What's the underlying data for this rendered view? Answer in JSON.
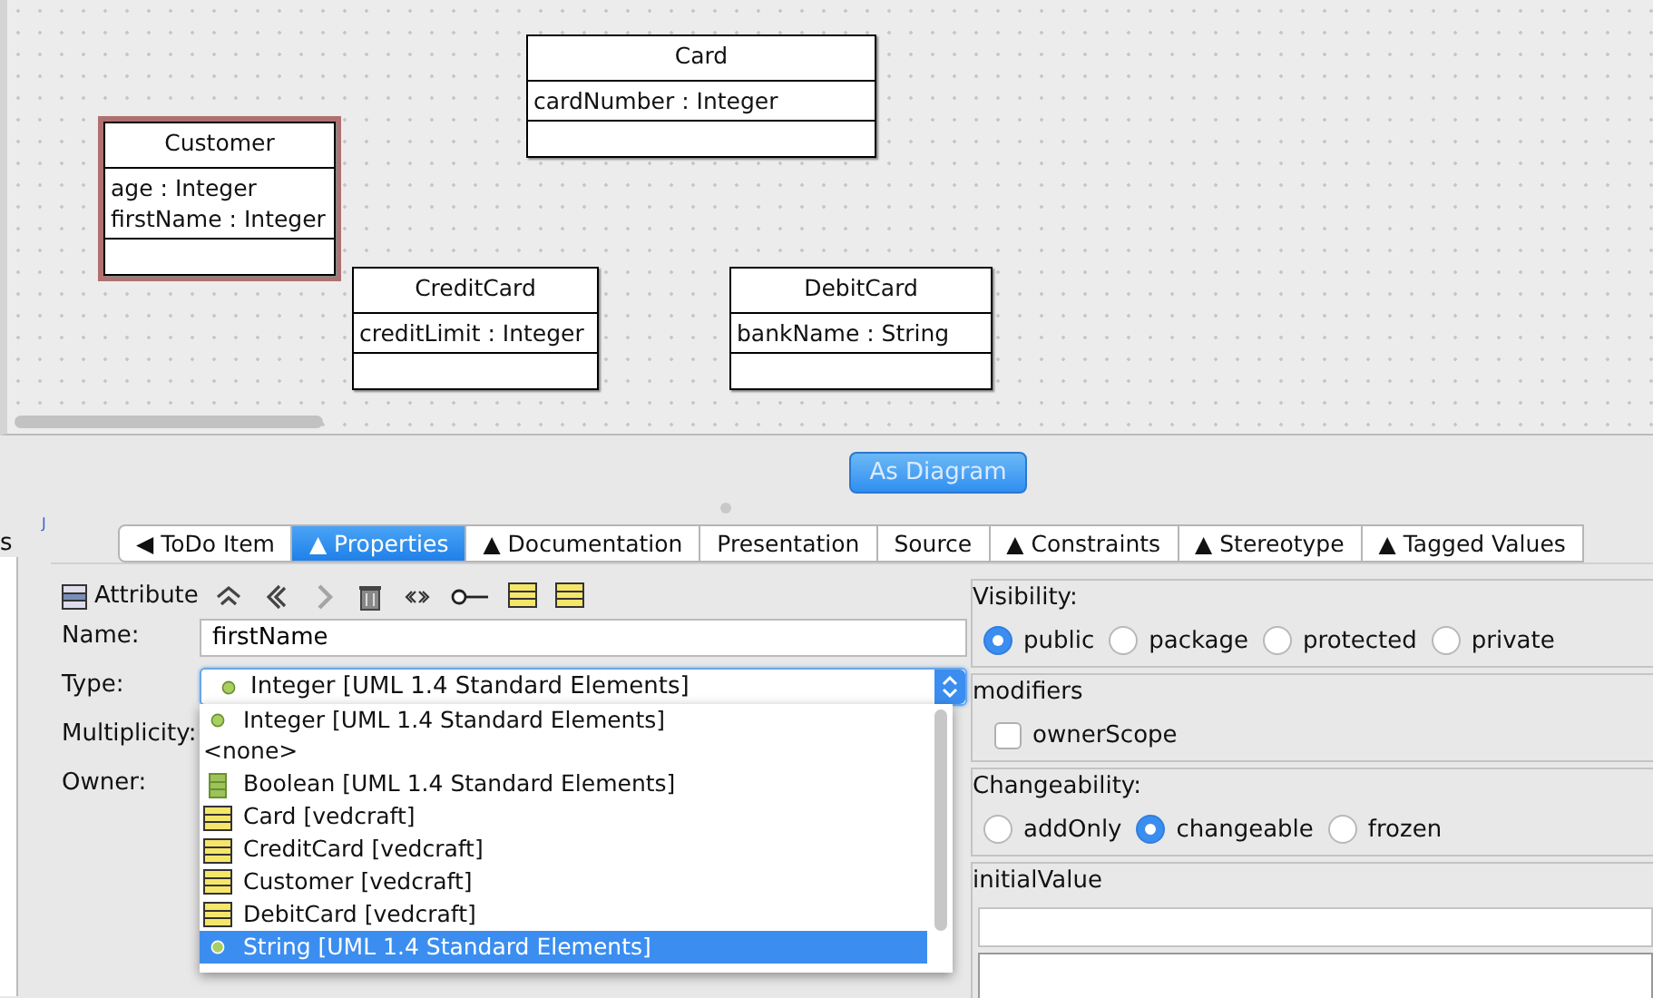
{
  "diagram": {
    "classes": [
      {
        "name": "Card",
        "attributes": [
          "cardNumber : Integer"
        ],
        "selected": false
      },
      {
        "name": "Customer",
        "attributes": [
          "age : Integer",
          "firstName : Integer"
        ],
        "selected": true
      },
      {
        "name": "CreditCard",
        "attributes": [
          "creditLimit : Integer"
        ],
        "selected": false
      },
      {
        "name": "DebitCard",
        "attributes": [
          "bankName : String"
        ],
        "selected": false
      }
    ]
  },
  "view_button": "As Diagram",
  "side_panel": {
    "label": "s",
    "mark": "J"
  },
  "tabs": [
    {
      "label": "◀ ToDo Item",
      "selected": false
    },
    {
      "label": "▲ Properties",
      "selected": true
    },
    {
      "label": "▲ Documentation",
      "selected": false
    },
    {
      "label": "Presentation",
      "selected": false
    },
    {
      "label": "Source",
      "selected": false
    },
    {
      "label": "▲ Constraints",
      "selected": false
    },
    {
      "label": "▲ Stereotype",
      "selected": false
    },
    {
      "label": "▲ Tagged Values",
      "selected": false
    }
  ],
  "toolbar": {
    "title": "Attribute",
    "tools": [
      {
        "kind": "up",
        "disabled": false
      },
      {
        "kind": "back",
        "disabled": false
      },
      {
        "kind": "forward",
        "disabled": true
      },
      {
        "kind": "delete",
        "disabled": false
      },
      {
        "kind": "stereotype",
        "disabled": false
      },
      {
        "kind": "key",
        "disabled": false
      },
      {
        "kind": "class",
        "disabled": false
      },
      {
        "kind": "class",
        "disabled": false
      }
    ]
  },
  "fields": {
    "name_label": "Name:",
    "name_value": "firstName",
    "type_label": "Type:",
    "type_value": "Integer [UML 1.4 Standard Elements]",
    "multiplicity_label": "Multiplicity:",
    "owner_label": "Owner:"
  },
  "type_options": [
    {
      "label": "Integer [UML 1.4 Standard Elements]",
      "kind": "datatype",
      "selected": false
    },
    {
      "label": "<none>",
      "kind": "none",
      "selected": false
    },
    {
      "label": "Boolean [UML 1.4 Standard Elements]",
      "kind": "enumeration",
      "selected": false
    },
    {
      "label": "Card [vedcraft]",
      "kind": "class",
      "selected": false
    },
    {
      "label": "CreditCard [vedcraft]",
      "kind": "class",
      "selected": false
    },
    {
      "label": "Customer [vedcraft]",
      "kind": "class",
      "selected": false
    },
    {
      "label": "DebitCard [vedcraft]",
      "kind": "class",
      "selected": false
    },
    {
      "label": "String [UML 1.4 Standard Elements]",
      "kind": "datatype",
      "selected": true
    }
  ],
  "visibility": {
    "title": "Visibility:",
    "options": [
      {
        "label": "public",
        "selected": true
      },
      {
        "label": "package",
        "selected": false
      },
      {
        "label": "protected",
        "selected": false
      },
      {
        "label": "private",
        "selected": false
      }
    ]
  },
  "modifiers": {
    "title": "modifiers",
    "options": [
      {
        "label": "ownerScope",
        "checked": false
      }
    ]
  },
  "changeability": {
    "title": "Changeability:",
    "options": [
      {
        "label": "addOnly",
        "selected": false
      },
      {
        "label": "changeable",
        "selected": true
      },
      {
        "label": "frozen",
        "selected": false
      }
    ]
  },
  "initial_value": {
    "title": "initialValue"
  }
}
